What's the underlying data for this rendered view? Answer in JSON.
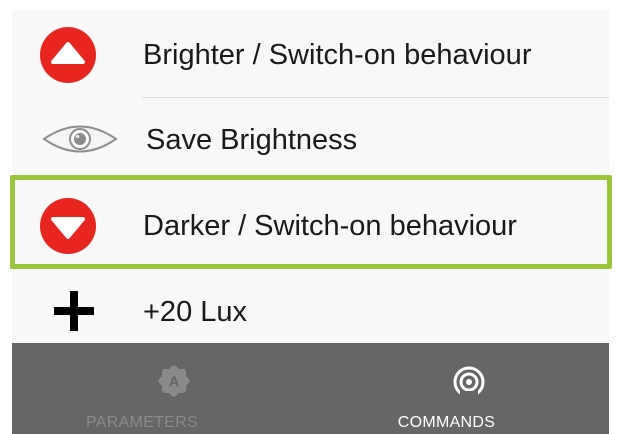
{
  "list": {
    "items": [
      {
        "label": "Brighter / Switch-on behaviour",
        "icon": "arrow-up-circle-icon"
      },
      {
        "label": "Save Brightness",
        "icon": "eye-icon"
      },
      {
        "label": "Darker / Switch-on behaviour",
        "icon": "arrow-down-circle-icon",
        "selected": true
      },
      {
        "label": "+20 Lux",
        "icon": "plus-icon"
      }
    ]
  },
  "tabbar": {
    "tabs": [
      {
        "label": "PARAMETERS",
        "icon": "parameters-gear-icon",
        "active": false
      },
      {
        "label": "COMMANDS",
        "icon": "broadcast-icon",
        "active": true
      }
    ]
  },
  "colors": {
    "accent_red": "#e8261f",
    "selection_green": "#9bc53d",
    "tabbar_bg": "#666666",
    "tab_active": "#ffffff",
    "tab_inactive": "#8a8a8a"
  }
}
